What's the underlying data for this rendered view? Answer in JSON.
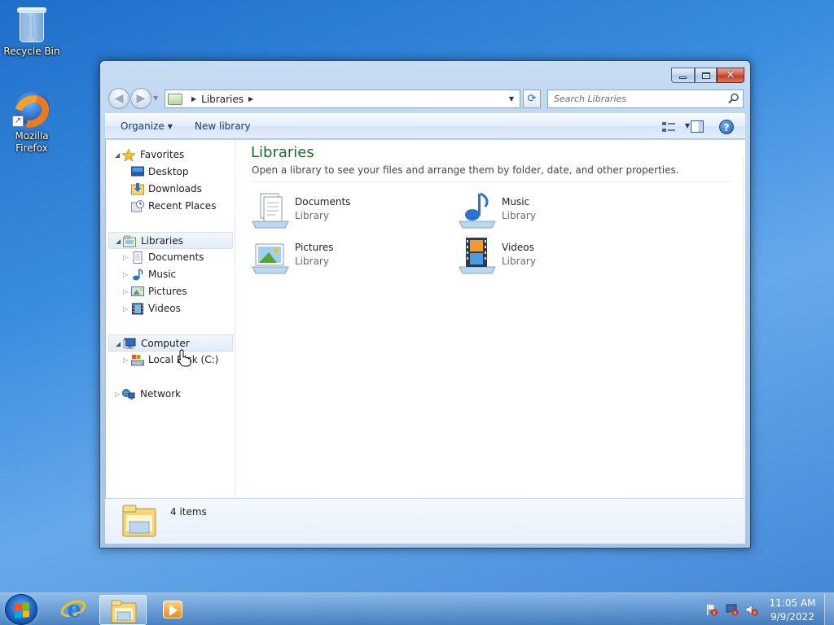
{
  "desktop": {
    "icons": [
      {
        "label": "Recycle Bin"
      },
      {
        "label": "Mozilla Firefox"
      }
    ]
  },
  "window": {
    "address": {
      "crumb": "Libraries",
      "search_placeholder": "Search Libraries"
    },
    "commands": {
      "organize": "Organize",
      "new_library": "New library"
    },
    "nav_tree": {
      "favorites": "Favorites",
      "desktop": "Desktop",
      "downloads": "Downloads",
      "recent_places": "Recent Places",
      "libraries": "Libraries",
      "documents": "Documents",
      "music": "Music",
      "pictures": "Pictures",
      "videos": "Videos",
      "computer": "Computer",
      "local_disk": "Local Disk (C:)",
      "network": "Network"
    },
    "main": {
      "title": "Libraries",
      "subtitle": "Open a library to see your files and arrange them by folder, date, and other properties.",
      "libraries": [
        {
          "name": "Documents",
          "type": "Library"
        },
        {
          "name": "Music",
          "type": "Library"
        },
        {
          "name": "Pictures",
          "type": "Library"
        },
        {
          "name": "Videos",
          "type": "Library"
        }
      ]
    },
    "details": {
      "count": "4 items"
    }
  },
  "taskbar": {
    "time": "11:05 AM",
    "date": "9/9/2022"
  },
  "colors": {
    "title_green": "#1e6b2e",
    "desktop_blue": "#3b8de0",
    "selection": "#e1ecf9"
  }
}
